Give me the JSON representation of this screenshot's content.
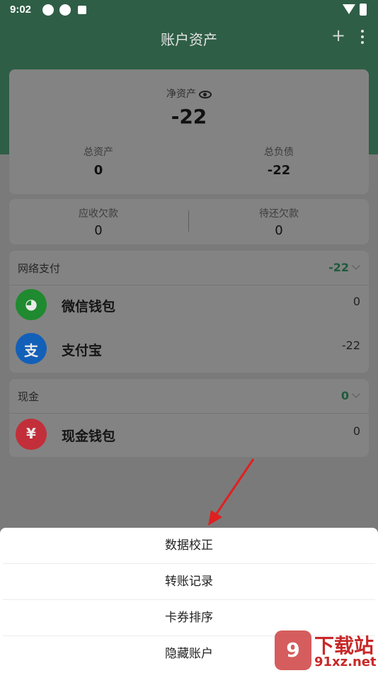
{
  "status_bar": {
    "time": "9:02"
  },
  "app_bar": {
    "title": "账户资产",
    "add_label": "+"
  },
  "summary": {
    "net_assets_label": "净资产",
    "net_assets_value": "-22",
    "total_assets_label": "总资产",
    "total_assets_value": "0",
    "total_liabilities_label": "总负债",
    "total_liabilities_value": "-22"
  },
  "receivables": {
    "receivable_label": "应收欠款",
    "receivable_value": "0",
    "payable_label": "待还欠款",
    "payable_value": "0"
  },
  "groups": [
    {
      "name": "网络支付",
      "total": "-22",
      "accounts": [
        {
          "name": "微信钱包",
          "amount": "0",
          "icon": "wechat-icon",
          "color": "#1f8a2f"
        },
        {
          "name": "支付宝",
          "amount": "-22",
          "icon": "alipay-icon",
          "color": "#1360b8"
        }
      ]
    },
    {
      "name": "现金",
      "total": "0",
      "accounts": [
        {
          "name": "现金钱包",
          "amount": "0",
          "icon": "cash-icon",
          "color": "#c22f3a"
        }
      ]
    }
  ],
  "menu": {
    "items": [
      "数据校正",
      "转账记录",
      "卡券排序",
      "隐藏账户"
    ]
  },
  "watermark": {
    "brand": "下载站",
    "site": "91xz.net"
  },
  "colors": {
    "header_green": "#2f5e46",
    "accent_green": "#1f5a3d",
    "arrow_red": "#e02020"
  }
}
